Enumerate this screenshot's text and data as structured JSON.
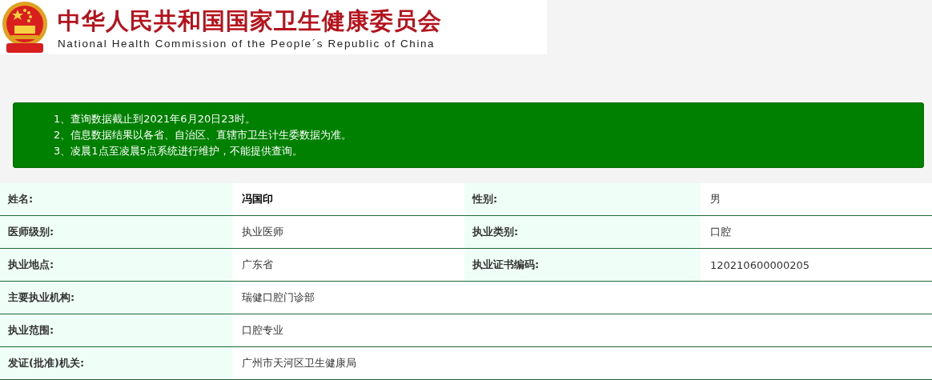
{
  "header": {
    "title": "中华人民共和国国家卫生健康委员会",
    "subtitle": "National Health Commission of the People´s Republic of China"
  },
  "notice": [
    "1、查询数据截止到2021年6月20日23时。",
    "2、信息数据结果以各省、自治区、直辖市卫生计生委数据为准。",
    "3、凌晨1点至凌晨5点系统进行维护，不能提供查询。"
  ],
  "rows": [
    {
      "fields": [
        {
          "label": "姓名:",
          "value": "冯国印",
          "bold": true
        },
        {
          "label": "性别:",
          "value": "男",
          "bold": false
        }
      ]
    },
    {
      "fields": [
        {
          "label": "医师级别:",
          "value": "执业医师",
          "bold": false
        },
        {
          "label": "执业类别:",
          "value": "口腔",
          "bold": false
        }
      ]
    },
    {
      "fields": [
        {
          "label": "执业地点:",
          "value": "广东省",
          "bold": false
        },
        {
          "label": "执业证书编码:",
          "value": "120210600000205",
          "bold": false
        }
      ]
    },
    {
      "fields": [
        {
          "label": "主要执业机构:",
          "value": "瑞健口腔门诊部",
          "bold": false
        }
      ]
    },
    {
      "fields": [
        {
          "label": "执业范围:",
          "value": "口腔专业",
          "bold": false
        }
      ]
    },
    {
      "fields": [
        {
          "label": "发证(批准)机关:",
          "value": "广州市天河区卫生健康局",
          "bold": false
        }
      ]
    }
  ]
}
